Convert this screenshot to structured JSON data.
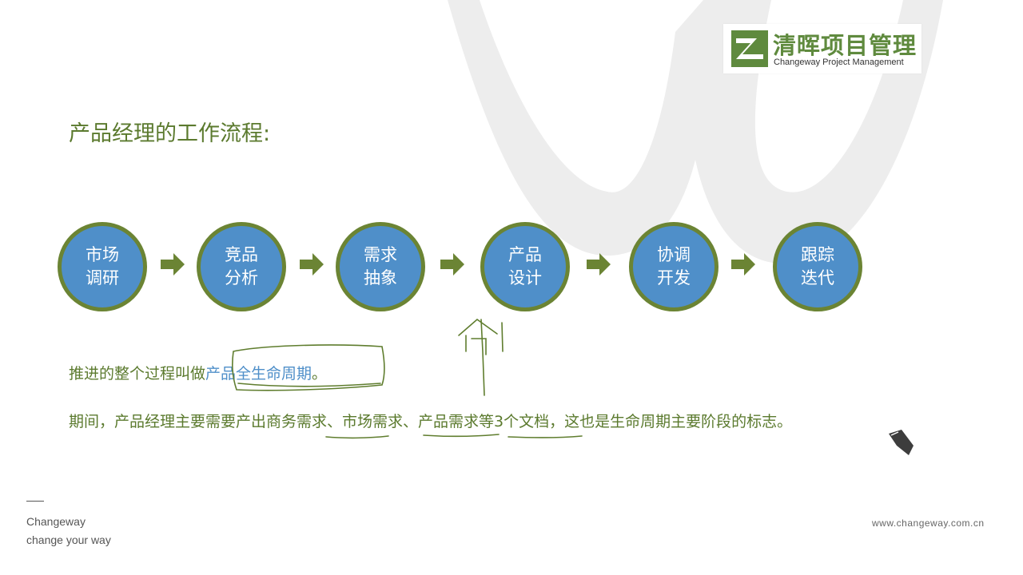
{
  "logo": {
    "name_cn": "清晖项目管理",
    "name_en": "Changeway Project Management"
  },
  "slide": {
    "title": "产品经理的工作流程:",
    "steps": [
      {
        "line1": "市场",
        "line2": "调研"
      },
      {
        "line1": "竞品",
        "line2": "分析"
      },
      {
        "line1": "需求",
        "line2": "抽象"
      },
      {
        "line1": "产品",
        "line2": "设计"
      },
      {
        "line1": "协调",
        "line2": "开发"
      },
      {
        "line1": "跟踪",
        "line2": "迭代"
      }
    ],
    "para1": {
      "prefix": "推进的整个过程叫做",
      "highlight": "产品全生命周期",
      "suffix": "。"
    },
    "para2": "期间，产品经理主要需要产出商务需求、市场需求、产品需求等3个文档，这也是生命周期主要阶段的标志。"
  },
  "footer": {
    "brand": "Changeway",
    "tagline": "change your way",
    "url": "www.changeway.com.cn"
  },
  "colors": {
    "circle_fill": "#4f8fc9",
    "circle_border": "#6b8434",
    "text_green": "#5b7a2e",
    "highlight_blue": "#4f8fc9"
  }
}
